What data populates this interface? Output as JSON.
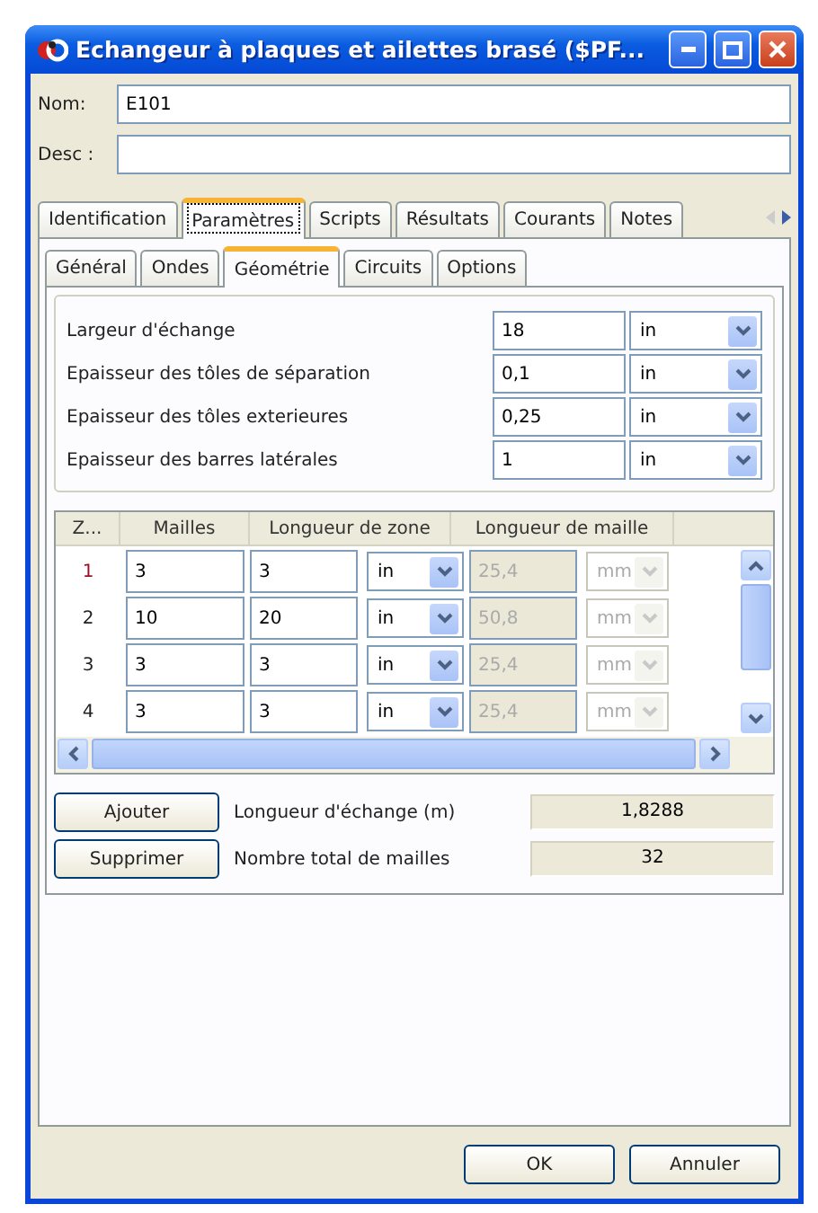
{
  "window": {
    "title": "Echangeur à plaques et ailettes brasé ($PF..."
  },
  "header_fields": [
    {
      "label": "Nom:",
      "value": "E101"
    },
    {
      "label": "Desc :"
    }
  ],
  "tabs": [
    {
      "label": "Identification",
      "selected": false
    },
    {
      "label": "Paramètres",
      "selected": true
    },
    {
      "label": "Scripts",
      "selected": false
    },
    {
      "label": "Résultats",
      "selected": false
    },
    {
      "label": "Courants",
      "selected": false
    },
    {
      "label": "Notes",
      "selected": false
    }
  ],
  "subtabs": [
    {
      "label": "Général",
      "selected": false
    },
    {
      "label": "Ondes",
      "selected": false
    },
    {
      "label": "Géométrie",
      "selected": true
    },
    {
      "label": "Circuits",
      "selected": false
    },
    {
      "label": "Options",
      "selected": false
    }
  ],
  "geometry": [
    {
      "label": "Largeur d'échange",
      "value": "18",
      "unit": "in"
    },
    {
      "label": "Epaisseur des tôles de séparation",
      "value": "0,1",
      "unit": "in"
    },
    {
      "label": "Epaisseur des tôles exterieures",
      "value": "0,25",
      "unit": "in"
    },
    {
      "label": "Epaisseur des barres latérales",
      "value": "1",
      "unit": "in"
    }
  ],
  "table": {
    "columns": [
      "Z...",
      "Mailles",
      "Longueur de zone",
      "Longueur de maille"
    ],
    "rows": [
      {
        "zone": "1",
        "selected": true,
        "mailles": "3",
        "length": "3",
        "unit": "in",
        "mesh_length": "25,4",
        "mesh_unit": "mm",
        "disabled": true
      },
      {
        "zone": "2",
        "selected": false,
        "mailles": "10",
        "length": "20",
        "unit": "in",
        "mesh_length": "50,8",
        "mesh_unit": "mm",
        "disabled": true
      },
      {
        "zone": "3",
        "selected": false,
        "mailles": "3",
        "length": "3",
        "unit": "in",
        "mesh_length": "25,4",
        "mesh_unit": "mm",
        "disabled": true
      },
      {
        "zone": "4",
        "selected": false,
        "mailles": "3",
        "length": "3",
        "unit": "in",
        "mesh_length": "25,4",
        "mesh_unit": "mm",
        "disabled": true
      }
    ]
  },
  "actions": [
    {
      "button": "Ajouter",
      "label": "Longueur d'échange (m)",
      "value": "1,8288"
    },
    {
      "button": "Supprimer",
      "label": "Nombre total de mailles",
      "value": "32"
    }
  ],
  "buttons": [
    "OK",
    "Annuler"
  ]
}
